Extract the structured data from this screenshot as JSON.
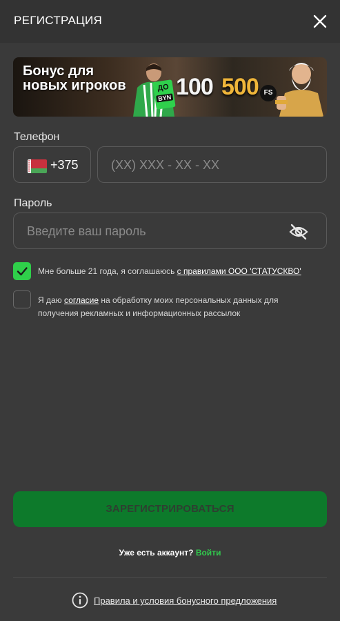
{
  "header": {
    "title": "РЕГИСТРАЦИЯ",
    "close_icon": "close-icon"
  },
  "banner": {
    "headline": "Бонус для новых игроков",
    "do_label": "ДО",
    "currency": "BYN",
    "amount_1": "100",
    "amount_2": "500",
    "fs_label": "FS"
  },
  "phone": {
    "label": "Телефон",
    "country_code": "+375",
    "flag": "belarus-flag-icon",
    "placeholder": "(XX) XXX - XX - XX"
  },
  "password": {
    "label": "Пароль",
    "placeholder": "Введите ваш пароль",
    "toggle_icon": "eye-off-icon"
  },
  "agreements": [
    {
      "checked": true,
      "text_before": "Мне больше 21 года, я соглашаюсь ",
      "link_text": "с правилами ООО 'СТАТУСКВО'",
      "text_after": ""
    },
    {
      "checked": false,
      "text_before": "Я даю ",
      "link_text": "согласие",
      "text_after": " на обработку моих персональных данных для получения рекламных и информационных рассылок"
    }
  ],
  "register_button": "ЗАРЕГИСТРИРОВАТЬСЯ",
  "login": {
    "prompt": "Уже есть аккаунт?",
    "link": "Войти"
  },
  "rules_link": "Правила и условия бонусного предложения",
  "colors": {
    "background": "#3a3a3a",
    "header": "#333333",
    "accent_green": "#2fcf4a",
    "button_green": "#0d7a2b"
  }
}
